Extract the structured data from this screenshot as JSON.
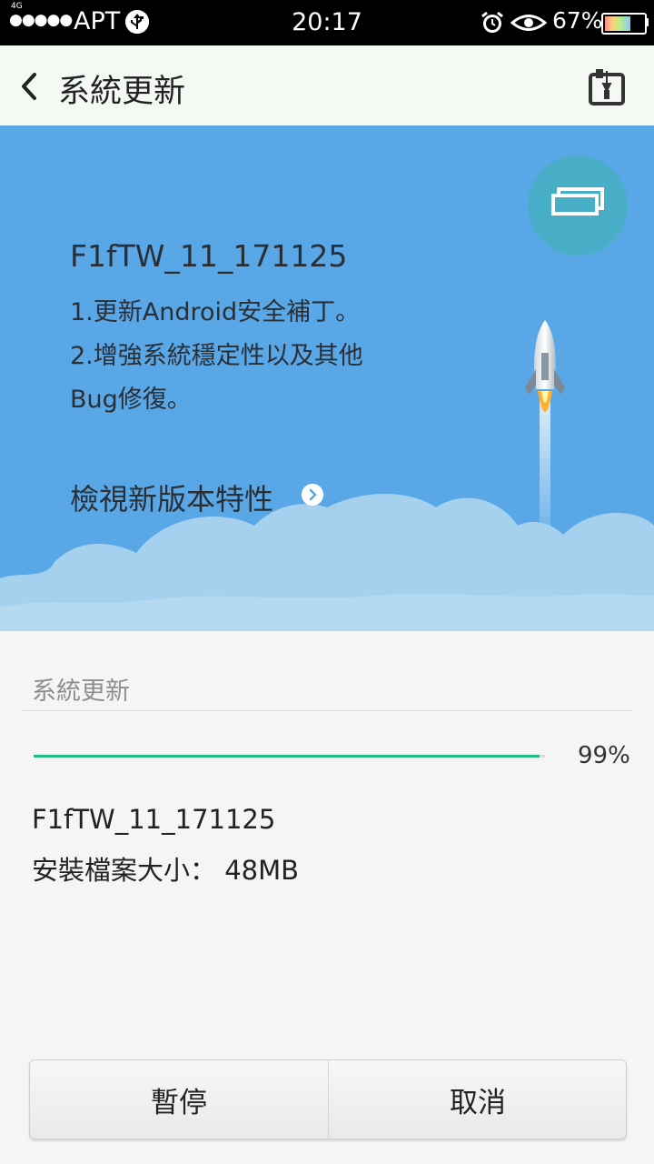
{
  "status_bar": {
    "network": "4G",
    "signal_dots": "●●●●●",
    "carrier": "APT",
    "time": "20:17",
    "battery_percent": "67%",
    "battery_level": 0.67,
    "icons": [
      "usb-icon",
      "alarm-icon",
      "eye-icon",
      "battery-icon"
    ]
  },
  "app_bar": {
    "title": "系統更新",
    "icons": [
      "back-arrow-icon",
      "toolbox-icon"
    ]
  },
  "hero": {
    "version": "F1fTW_11_171125",
    "notes": [
      "1.更新Android安全補丁。",
      "2.增強系統穩定性以及其他",
      "Bug修復。"
    ],
    "view_features_label": "檢視新版本特性",
    "colors": {
      "background": "#59a7e6",
      "circle": "#48aec7",
      "clouds": "#a6d1ee"
    }
  },
  "update_section": {
    "title": "系統更新",
    "progress_percent_text": "99%",
    "progress_value": 0.99,
    "version": "F1fTW_11_171125",
    "size_label": "安裝檔案大小：",
    "size_value": "48MB",
    "progress_color": "#1ebe83"
  },
  "actions": {
    "pause_label": "暫停",
    "cancel_label": "取消"
  }
}
